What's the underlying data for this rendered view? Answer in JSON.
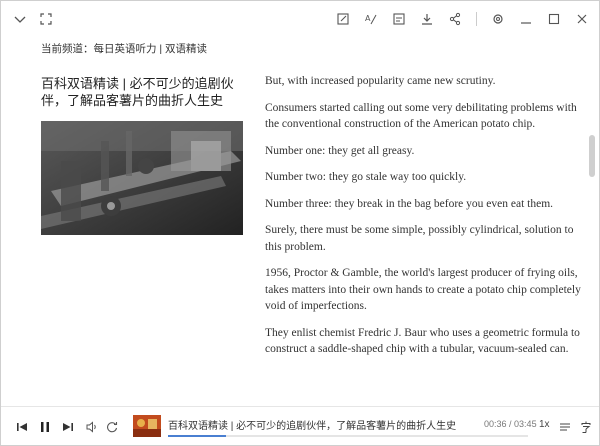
{
  "channel": {
    "label": "当前频道：",
    "name": "每日英语听力 | 双语精读"
  },
  "article": {
    "title": "百科双语精读 | 必不可少的追剧伙伴，了解品客薯片的曲折人生史",
    "paragraphs": [
      "But, with increased popularity came new scrutiny.",
      "Consumers started calling out some very debilitating problems with the conventional construction of the American potato chip.",
      "Number one: they get all greasy.",
      "Number two: they go stale way too quickly.",
      "Number three: they break in the bag before you even eat them.",
      "Surely, there must be some simple, possibly cylindrical, solution to this problem.",
      "1956, Proctor & Gamble, the world's largest producer of frying oils, takes matters into their own hands to create a potato chip completely void of imperfections.",
      "They enlist chemist Fredric J. Baur who uses a geometric formula to construct a saddle-shaped chip with a tubular, vacuum-sealed can."
    ]
  },
  "player": {
    "track_title": "百科双语精读 | 必不可少的追剧伙伴，了解品客薯片的曲折人生史",
    "current_time": "00:36",
    "total_time": "03:45",
    "time_separator": " / ",
    "speed": "1x",
    "progress": 0.16
  },
  "colors": {
    "accent": "#4a7fd1",
    "thumb": "#c24b1d"
  }
}
